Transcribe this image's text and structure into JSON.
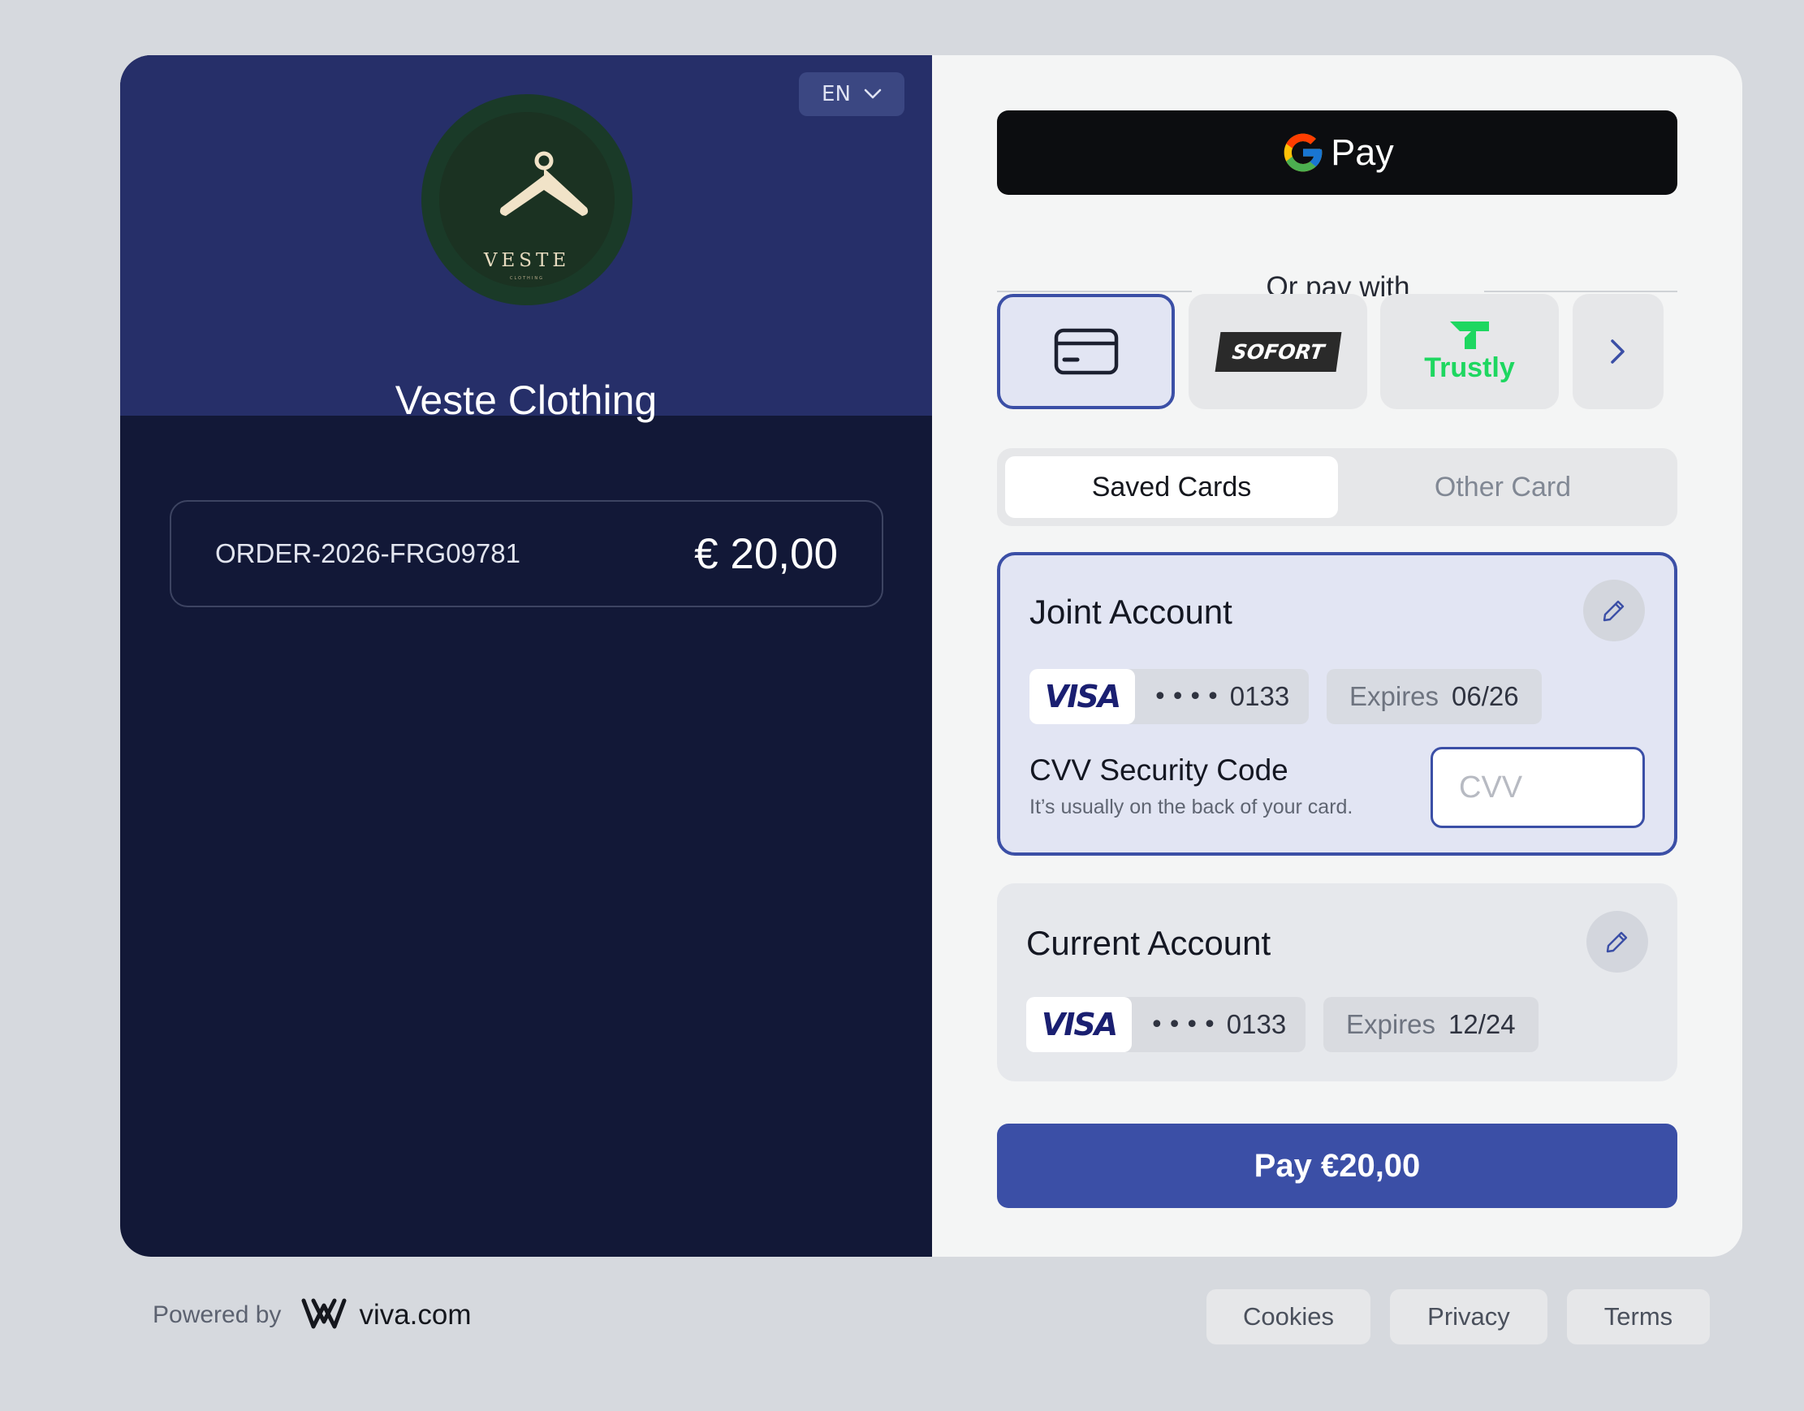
{
  "merchant": {
    "name": "Veste Clothing",
    "logo_text": "VESTE",
    "logo_subtext": "CLOTHING",
    "logo_colors": {
      "ring": "#1a3a28",
      "inner": "#1b3222",
      "mark": "#f1e3c8"
    }
  },
  "language": {
    "selected": "EN",
    "icon": "chevron-down-icon"
  },
  "order": {
    "id": "ORDER-2026-FRG09781",
    "amount": "€ 20,00"
  },
  "gpay": {
    "label": "Pay",
    "icon": "google-g-icon"
  },
  "methods": {
    "divider_text": "Or pay with",
    "options": [
      {
        "name": "Card",
        "icon": "credit-card-icon",
        "selected": true
      },
      {
        "name": "SOFORT",
        "label": "SOFORT"
      },
      {
        "name": "Trustly",
        "label": "Trustly",
        "color": "#1ed760"
      },
      {
        "name": "More",
        "icon": "chevron-right-icon"
      }
    ]
  },
  "tabs": {
    "saved": "Saved Cards",
    "other": "Other Card",
    "active": "saved"
  },
  "accounts": [
    {
      "title": "Joint Account",
      "brand": "VISA",
      "dots": "••••",
      "last4": "0133",
      "expires_label": "Expires",
      "expires": "06/26",
      "selected": true,
      "cvv": {
        "title": "CVV Security Code",
        "hint": "It’s usually on the back of your card.",
        "placeholder": "CVV"
      }
    },
    {
      "title": "Current Account",
      "brand": "VISA",
      "dots": "••••",
      "last4": "0133",
      "expires_label": "Expires",
      "expires": "12/24",
      "selected": false
    }
  ],
  "pay_button": {
    "label": "Pay €20,00",
    "color": "#3b4fa6"
  },
  "footer": {
    "powered_by": "Powered by",
    "brand": "viva.com",
    "links": [
      "Cookies",
      "Privacy",
      "Terms"
    ]
  },
  "colors": {
    "accent": "#3b4fa6",
    "left_header": "#262f69",
    "left_body": "#121837",
    "page_bg": "#d6d9de"
  }
}
